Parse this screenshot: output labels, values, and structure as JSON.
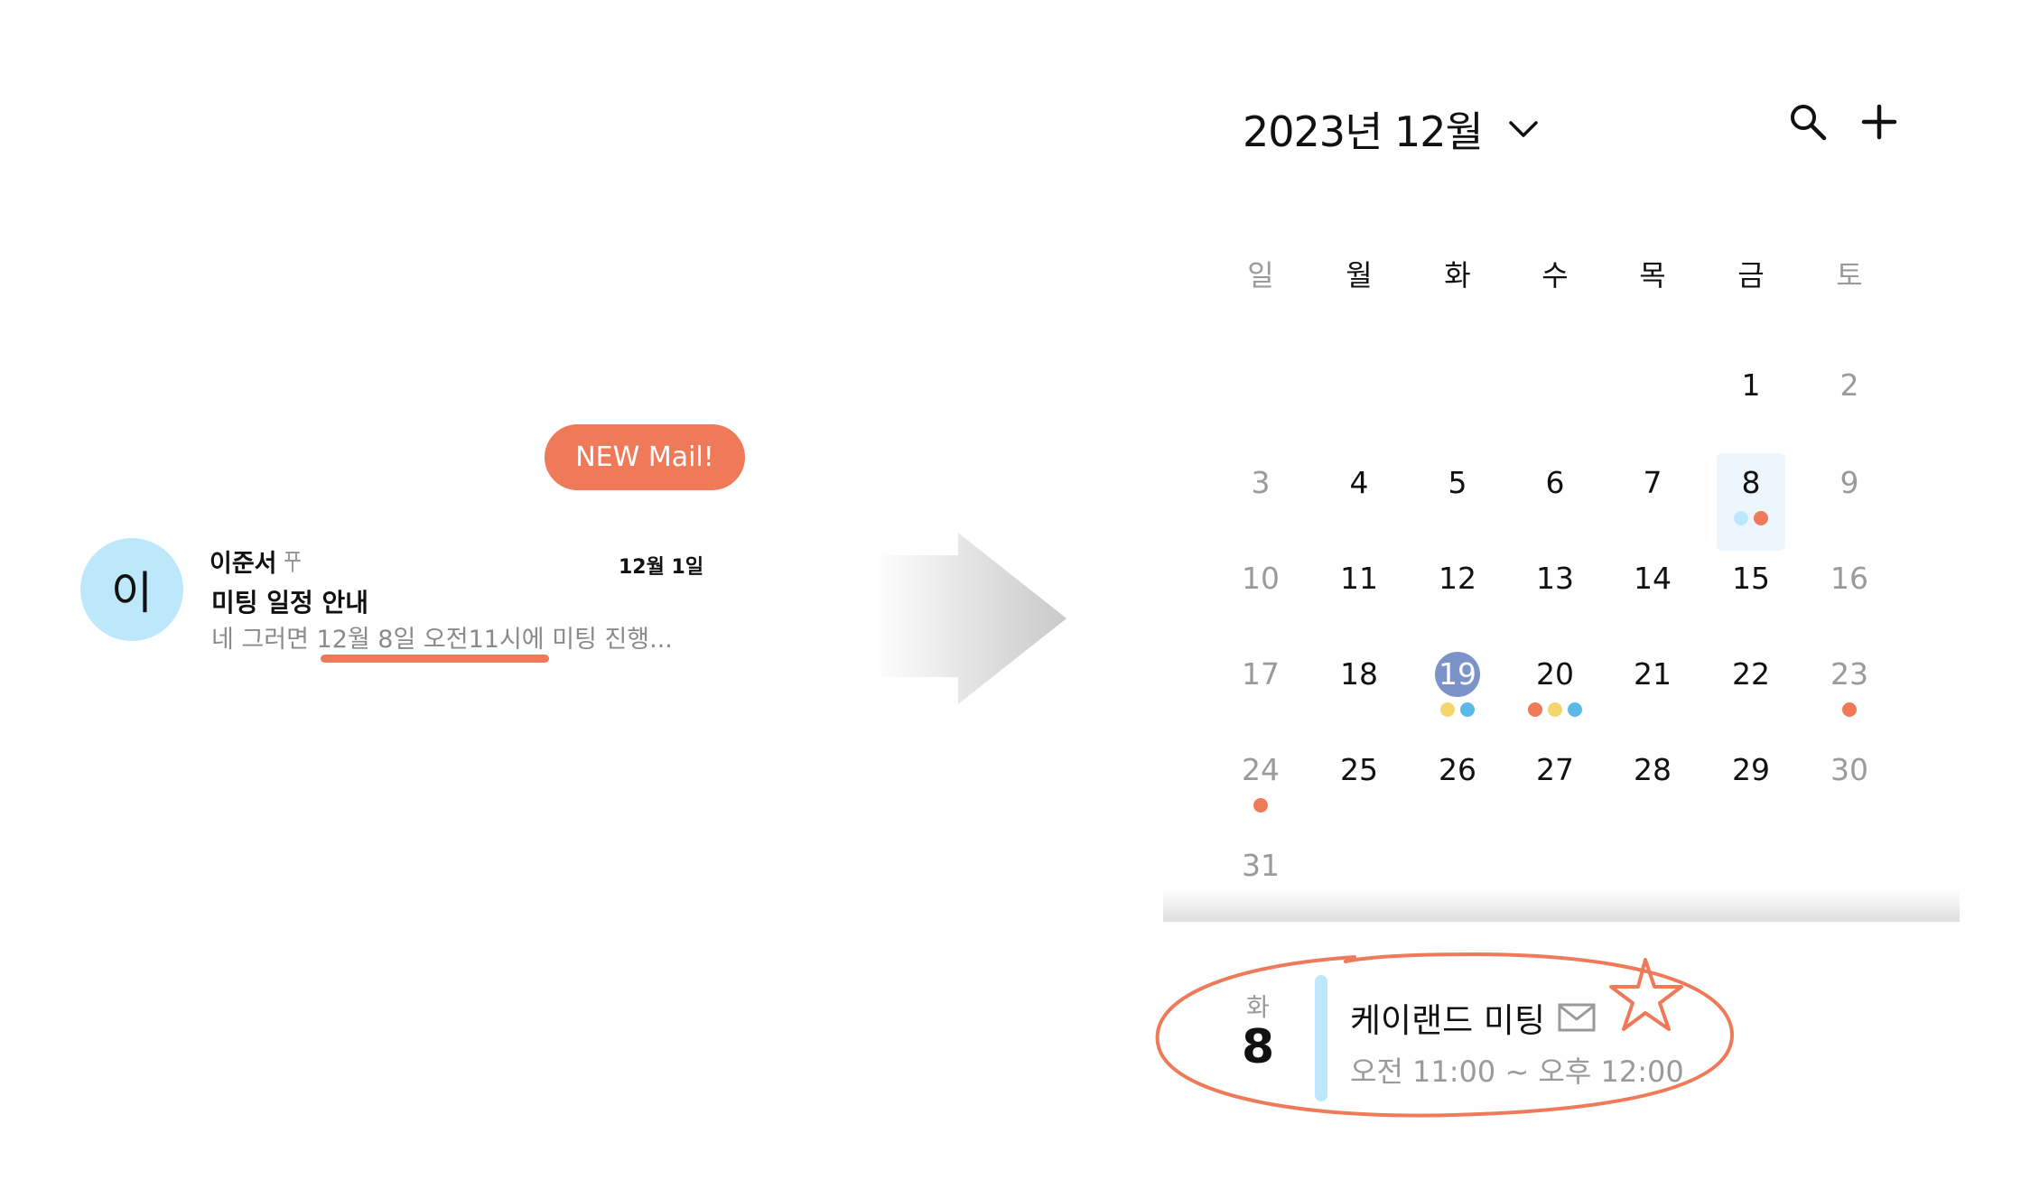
{
  "mail": {
    "badge": "NEW Mail!",
    "avatar_initial": "이",
    "sender": "이준서",
    "date": "12월 1일",
    "subject": "미팅 일정 안내",
    "preview": "네 그러면 12월 8일 오전11시에 미팅 진행..."
  },
  "calendar": {
    "title": "2023년 12월",
    "weekdays": [
      "일",
      "월",
      "화",
      "수",
      "목",
      "금",
      "토"
    ],
    "selected_day": "8",
    "today": "19",
    "days": [
      {
        "label": "1"
      },
      {
        "label": "2"
      },
      {
        "label": "3"
      },
      {
        "label": "4"
      },
      {
        "label": "5"
      },
      {
        "label": "6"
      },
      {
        "label": "7"
      },
      {
        "label": "8"
      },
      {
        "label": "9"
      },
      {
        "label": "10"
      },
      {
        "label": "11"
      },
      {
        "label": "12"
      },
      {
        "label": "13"
      },
      {
        "label": "14"
      },
      {
        "label": "15"
      },
      {
        "label": "16"
      },
      {
        "label": "17"
      },
      {
        "label": "18"
      },
      {
        "label": "19"
      },
      {
        "label": "20"
      },
      {
        "label": "21"
      },
      {
        "label": "22"
      },
      {
        "label": "23"
      },
      {
        "label": "24"
      },
      {
        "label": "25"
      },
      {
        "label": "26"
      },
      {
        "label": "27"
      },
      {
        "label": "28"
      },
      {
        "label": "29"
      },
      {
        "label": "30"
      },
      {
        "label": "31"
      }
    ],
    "event_dots": {
      "8": [
        "#bde8fb",
        "#ef7a5a"
      ],
      "19": [
        "#f5d66e",
        "#5bb8ea"
      ],
      "20": [
        "#ef7a5a",
        "#f5d66e",
        "#5bb8ea"
      ],
      "23": [
        "#ef7a5a"
      ],
      "24": [
        "#ef7a5a"
      ]
    }
  },
  "event": {
    "weekday": "화",
    "day": "8",
    "title": "케이랜드 미팅",
    "time": "오전 11:00 ~ 오후 12:00"
  },
  "colors": {
    "accent": "#ef7a5a",
    "avatar_bg": "#bde8fb",
    "today_circle": "#7b93c9",
    "selected_bg": "#eef6fd",
    "event_bar": "#bde8fb"
  }
}
